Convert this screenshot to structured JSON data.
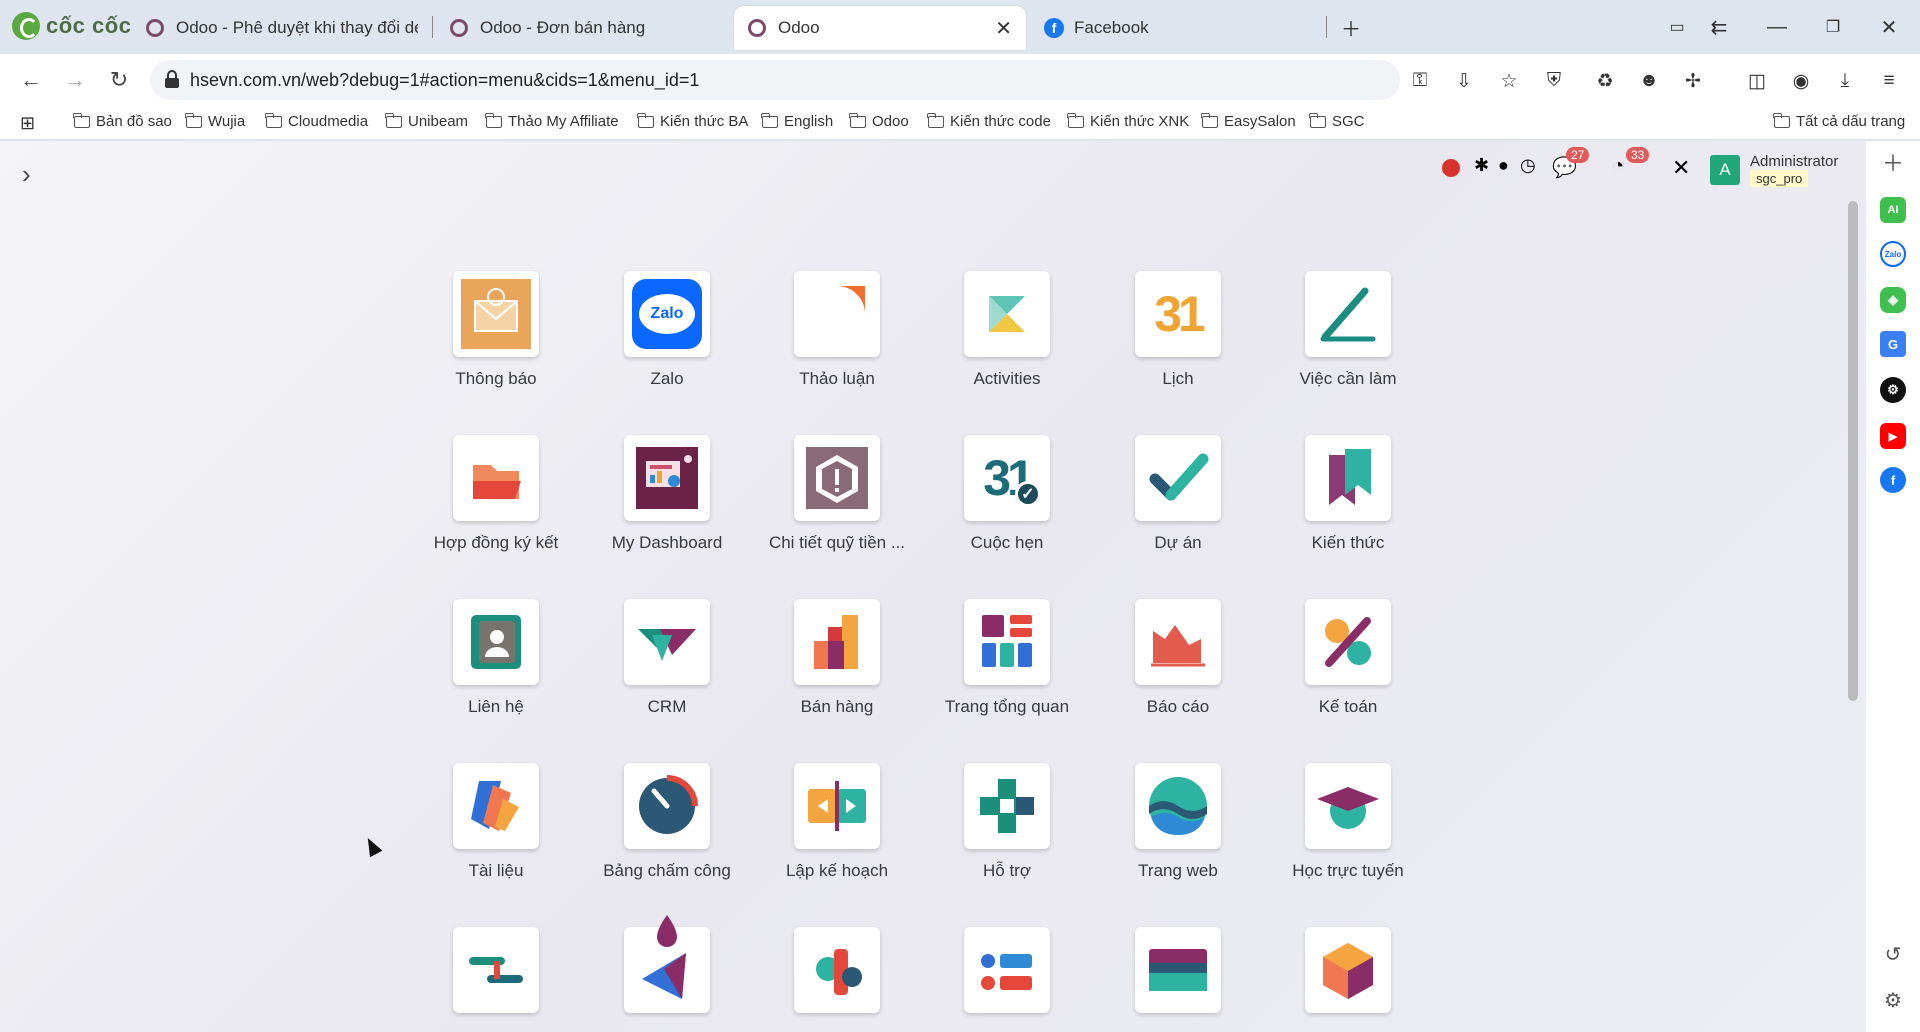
{
  "browser": {
    "brand": "cốc cốc",
    "tabs": [
      {
        "label": "Odoo - Phê duyệt khi thay đổi de"
      },
      {
        "label": "Odoo - Đơn bán hàng"
      },
      {
        "label": "Odoo"
      },
      {
        "label": "Facebook"
      }
    ],
    "url": "hsevn.com.vn/web?debug=1#action=menu&cids=1&menu_id=1",
    "bookmarks": [
      "Bản đồ sao",
      "Wujia",
      "Cloudmedia",
      "Unibeam",
      "Thảo My Affiliate",
      "Kiến thức BA",
      "English",
      "Odoo",
      "Kiến thức code",
      "Kiến thức XNK",
      "EasySalon",
      "SGC"
    ],
    "all_bookmarks": "Tất cả dấu trang"
  },
  "systray": {
    "messages_count": "27",
    "activities_count": "33",
    "user_initial": "A",
    "user_name": "Administrator",
    "database": "sgc_pro"
  },
  "side_panel": {
    "ai_label": "AI",
    "zalo_label": "Zalo"
  },
  "apps": [
    {
      "label": "Thông báo"
    },
    {
      "label": "Zalo"
    },
    {
      "label": "Thảo luận"
    },
    {
      "label": "Activities"
    },
    {
      "label": "Lịch"
    },
    {
      "label": "Việc cần làm"
    },
    {
      "label": "Hợp đồng ký kết"
    },
    {
      "label": "My Dashboard"
    },
    {
      "label": "Chi tiết quỹ tiền ..."
    },
    {
      "label": "Cuộc hẹn"
    },
    {
      "label": "Dự án"
    },
    {
      "label": "Kiến thức"
    },
    {
      "label": "Liên hệ"
    },
    {
      "label": "CRM"
    },
    {
      "label": "Bán hàng"
    },
    {
      "label": "Trang tổng quan"
    },
    {
      "label": "Báo cáo"
    },
    {
      "label": "Kế toán"
    },
    {
      "label": "Tài liệu"
    },
    {
      "label": "Bảng chấm công"
    },
    {
      "label": "Lập kế hoạch"
    },
    {
      "label": "Hỗ trợ"
    },
    {
      "label": "Trang web"
    },
    {
      "label": "Học trực tuyến"
    }
  ],
  "icon_texts": {
    "zalo": "Zalo",
    "calendar": "31"
  }
}
